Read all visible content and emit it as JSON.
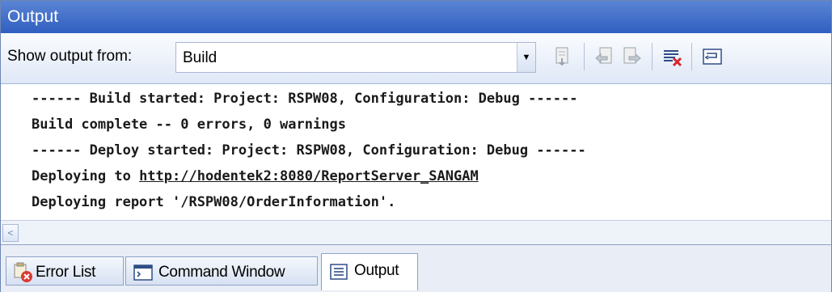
{
  "window": {
    "title": "Output"
  },
  "toolbar": {
    "label": "Show output from:",
    "selected_source": "Build",
    "buttons": [
      {
        "name": "find-message-in-code-icon"
      },
      {
        "name": "go-to-previous-message-icon"
      },
      {
        "name": "go-to-next-message-icon"
      },
      {
        "name": "clear-all-icon"
      },
      {
        "name": "toggle-word-wrap-icon"
      }
    ]
  },
  "output": {
    "lines": [
      {
        "text": "------ Build started: Project: RSPW08, Configuration: Debug ------"
      },
      {
        "text": "Build complete -- 0 errors, 0 warnings"
      },
      {
        "text": "------ Deploy started: Project: RSPW08, Configuration: Debug ------"
      },
      {
        "prefix": "Deploying to ",
        "link": "http://hodentek2:8080/ReportServer_SANGAM"
      },
      {
        "text": "Deploying report '/RSPW08/OrderInformation'."
      }
    ]
  },
  "tabs": [
    {
      "label": "Error List",
      "icon": "error-list-icon"
    },
    {
      "label": "Command Window",
      "icon": "command-window-icon"
    },
    {
      "label": "Output",
      "icon": "output-icon",
      "active": true
    }
  ],
  "colors": {
    "titlebar": "#3a6bc9",
    "toolbar": "#e6edf8",
    "text": "#1a1a1a"
  }
}
